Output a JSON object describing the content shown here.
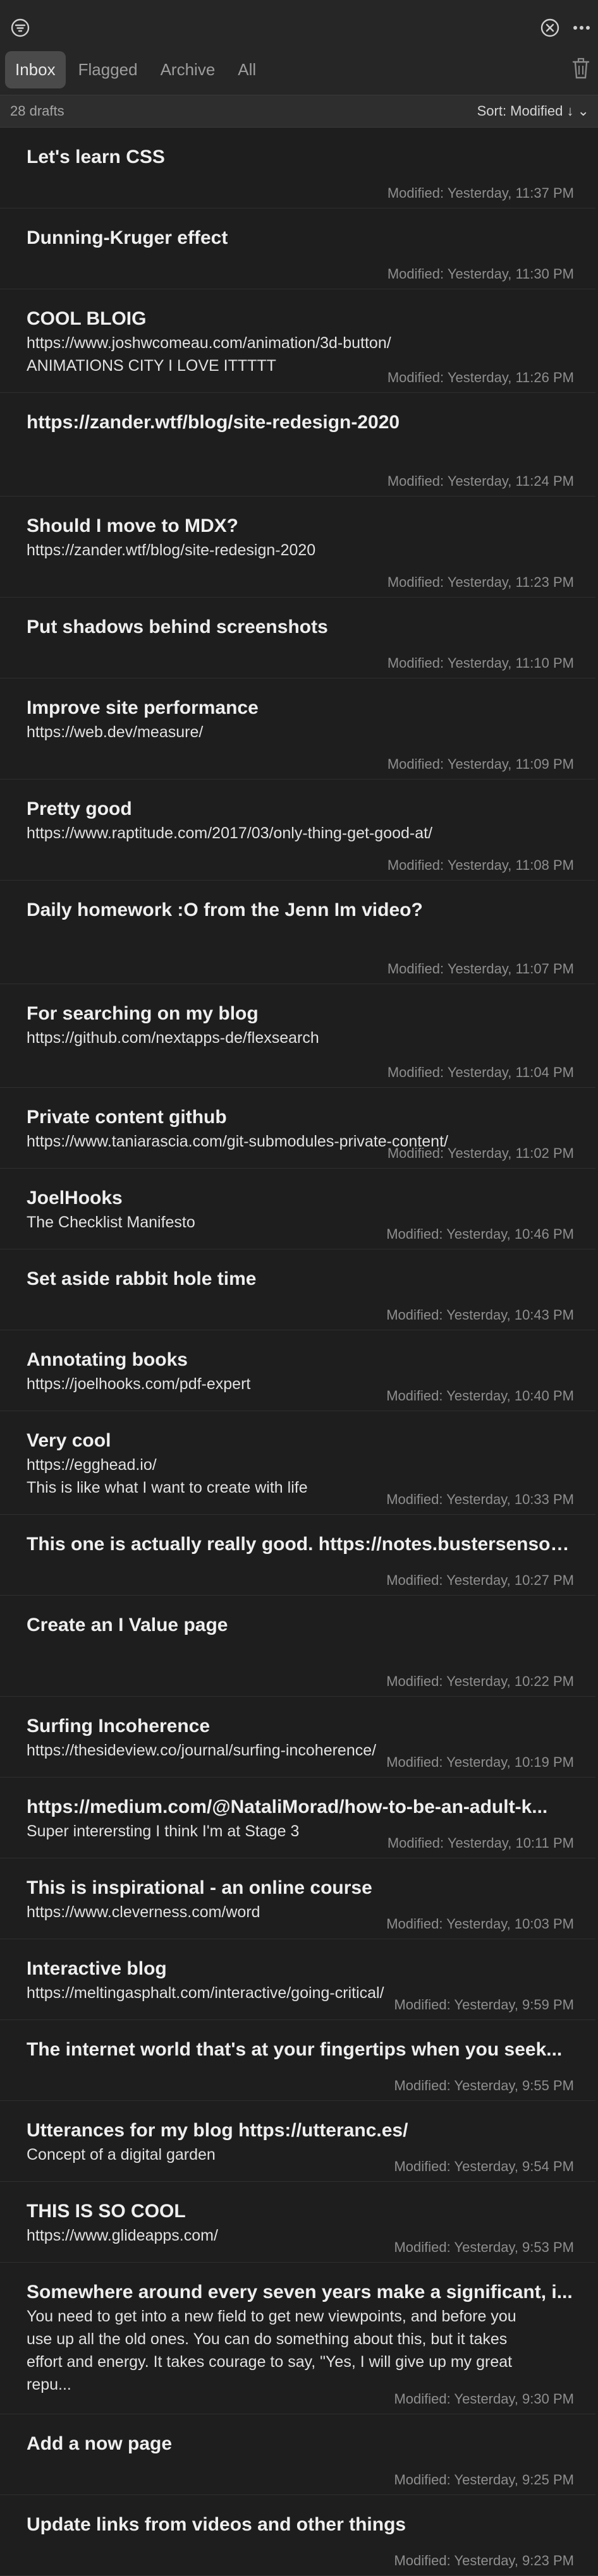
{
  "header": {
    "tabs": [
      {
        "label": "Inbox",
        "active": true
      },
      {
        "label": "Flagged",
        "active": false
      },
      {
        "label": "Archive",
        "active": false
      },
      {
        "label": "All",
        "active": false
      }
    ],
    "icons": {
      "filter": "filter-icon",
      "close": "close-circle-icon",
      "more": "more-icon",
      "trash": "trash-icon"
    }
  },
  "status": {
    "count": "28 drafts",
    "sort": "Sort: Modified ↓ ⌄"
  },
  "drafts": [
    {
      "title": "Let's learn CSS",
      "body": [],
      "modified": "Modified: Yesterday, 11:37 PM"
    },
    {
      "title": "Dunning-Kruger effect",
      "body": [],
      "modified": "Modified: Yesterday, 11:30 PM"
    },
    {
      "title": "COOL BLOIG",
      "body": [
        "https://www.joshwcomeau.com/animation/3d-button/",
        "ANIMATIONS CITY I LOVE ITTTTT"
      ],
      "modified": "Modified: Yesterday, 11:26 PM"
    },
    {
      "title": "https://zander.wtf/blog/site-redesign-2020",
      "body": [],
      "modified": "Modified: Yesterday, 11:24 PM"
    },
    {
      "title": "Should I move to MDX?",
      "body": [
        "https://zander.wtf/blog/site-redesign-2020"
      ],
      "modified": "Modified: Yesterday, 11:23 PM"
    },
    {
      "title": "Put shadows behind screenshots",
      "body": [],
      "modified": "Modified: Yesterday, 11:10 PM"
    },
    {
      "title": "Improve site performance",
      "body": [
        "https://web.dev/measure/"
      ],
      "modified": "Modified: Yesterday, 11:09 PM"
    },
    {
      "title": "Pretty good",
      "body": [
        "https://www.raptitude.com/2017/03/only-thing-get-good-at/"
      ],
      "modified": "Modified: Yesterday, 11:08 PM"
    },
    {
      "title": "Daily homework :O from the Jenn Im video?",
      "body": [],
      "modified": "Modified: Yesterday, 11:07 PM"
    },
    {
      "title": "For searching on my blog",
      "body": [
        "https://github.com/nextapps-de/flexsearch"
      ],
      "modified": "Modified: Yesterday, 11:04 PM"
    },
    {
      "title": "Private content github",
      "body": [
        "https://www.taniarascia.com/git-submodules-private-content/"
      ],
      "modified": "Modified: Yesterday, 11:02 PM"
    },
    {
      "title": "JoelHooks",
      "body": [
        "The Checklist Manifesto"
      ],
      "modified": "Modified: Yesterday, 10:46 PM"
    },
    {
      "title": "Set aside rabbit hole time",
      "body": [],
      "modified": "Modified: Yesterday, 10:43 PM"
    },
    {
      "title": "Annotating books",
      "body": [
        "https://joelhooks.com/pdf-expert"
      ],
      "modified": "Modified: Yesterday, 10:40 PM"
    },
    {
      "title": "Very cool",
      "body": [
        "https://egghead.io/",
        "This is like what I want to create with life"
      ],
      "modified": "Modified: Yesterday, 10:33 PM"
    },
    {
      "title": "This one is actually really good. https://notes.bustersenson...",
      "body": [],
      "modified": "Modified: Yesterday, 10:27 PM"
    },
    {
      "title": "Create an I Value page",
      "body": [],
      "modified": "Modified: Yesterday, 10:22 PM"
    },
    {
      "title": "Surfing Incoherence",
      "body": [
        "https://thesideview.co/journal/surfing-incoherence/"
      ],
      "modified": "Modified: Yesterday, 10:19 PM"
    },
    {
      "title": "https://medium.com/@NataliMorad/how-to-be-an-adult-k...",
      "body": [
        "Super interersting I think I'm at Stage 3"
      ],
      "modified": "Modified: Yesterday, 10:11 PM"
    },
    {
      "title": "This is inspirational - an online course",
      "body": [
        "https://www.cleverness.com/word"
      ],
      "modified": "Modified: Yesterday, 10:03 PM"
    },
    {
      "title": "Interactive blog",
      "body": [
        "https://meltingasphalt.com/interactive/going-critical/"
      ],
      "modified": "Modified: Yesterday, 9:59 PM"
    },
    {
      "title": "The internet world that's at your fingertips when you seek...",
      "body": [],
      "modified": "Modified: Yesterday, 9:55 PM"
    },
    {
      "title": "Utterances for my blog https://utteranc.es/",
      "body": [
        "Concept of a digital garden"
      ],
      "modified": "Modified: Yesterday, 9:54 PM"
    },
    {
      "title": "THIS IS SO COOL",
      "body": [
        "https://www.glideapps.com/"
      ],
      "modified": "Modified: Yesterday, 9:53 PM"
    },
    {
      "title": "Somewhere around every seven years make a significant, i...",
      "body": [
        "You need to get into a new field to get new viewpoints, and before you",
        "use up all the old ones. You can do something about this, but it takes",
        "effort and energy. It takes courage to say, \"Yes, I will give up my great",
        "repu..."
      ],
      "modified": "Modified: Yesterday, 9:30 PM"
    },
    {
      "title": "Add a now page",
      "body": [],
      "modified": "Modified: Yesterday, 9:25 PM"
    },
    {
      "title": "Update links from videos and other things",
      "body": [],
      "modified": "Modified: Yesterday, 9:23 PM"
    }
  ]
}
